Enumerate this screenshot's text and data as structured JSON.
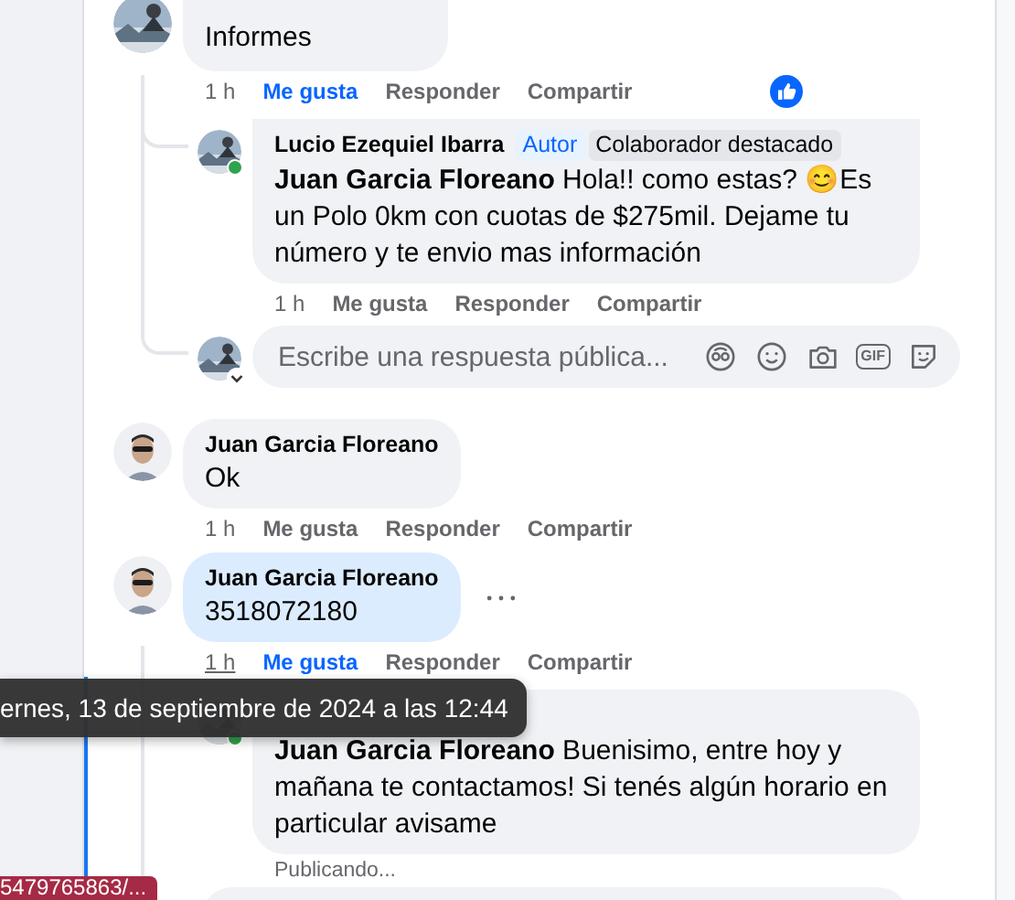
{
  "comments": [
    {
      "text": "Informes",
      "time": "1 h",
      "like_label": "Me gusta",
      "liked": true,
      "reply_label": "Responder",
      "share_label": "Compartir",
      "reaction_shown": true,
      "replies": [
        {
          "author": "Lucio Ezequiel Ibarra",
          "online": true,
          "badges": [
            {
              "label": "Autor",
              "kind": "author"
            },
            {
              "label": "Colaborador destacado",
              "kind": "contributor"
            }
          ],
          "mention": "Juan Garcia Floreano",
          "text": "Hola!! como estas? 😊Es un Polo 0km con cuotas de $275mil. Dejame tu número y te envio mas información",
          "time": "1 h",
          "like_label": "Me gusta",
          "liked": false,
          "reply_label": "Responder",
          "share_label": "Compartir"
        }
      ],
      "reply_box": {
        "placeholder": "Escribe una respuesta pública...",
        "gif_label": "GIF"
      }
    },
    {
      "author": "Juan Garcia Floreano",
      "text": "Ok",
      "time": "1 h",
      "like_label": "Me gusta",
      "liked": false,
      "reply_label": "Responder",
      "share_label": "Compartir"
    },
    {
      "author": "Juan Garcia Floreano",
      "text": "3518072180",
      "highlighted": true,
      "menu": true,
      "time": "1 h",
      "time_underlined": true,
      "like_label": "Me gusta",
      "liked": true,
      "reply_label": "Responder",
      "share_label": "Compartir",
      "replies": [
        {
          "online": true,
          "mention": "Juan Garcia Floreano",
          "text": "Buenisimo, entre hoy y mañana te contactamos! Si tenés algún horario en particular avisame",
          "status": "Publicando..."
        }
      ],
      "reply_field": true
    }
  ],
  "tooltip": "ernes, 13 de septiembre de 2024 a las 12:44",
  "status_link": "5479765863/..."
}
